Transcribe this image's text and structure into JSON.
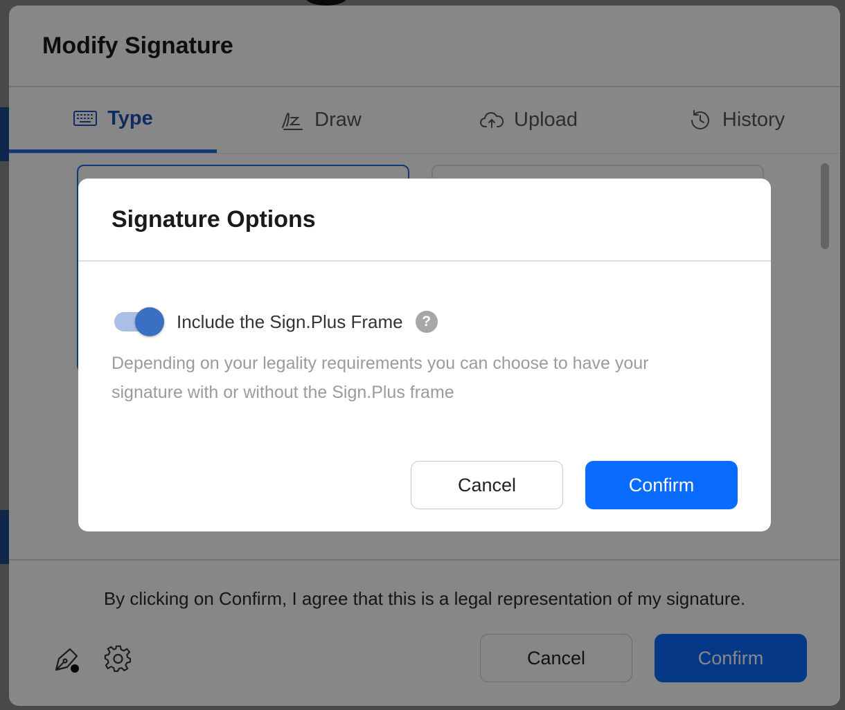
{
  "outer_modal": {
    "title": "Modify Signature",
    "tabs": [
      {
        "label": "Type",
        "icon": "keyboard-icon",
        "active": true
      },
      {
        "label": "Draw",
        "icon": "signature-draw-icon",
        "active": false
      },
      {
        "label": "Upload",
        "icon": "cloud-upload-icon",
        "active": false
      },
      {
        "label": "History",
        "icon": "history-icon",
        "active": false
      }
    ],
    "legal_text": "By clicking on Confirm, I agree that this is a legal representation of my signature.",
    "cancel_label": "Cancel",
    "confirm_label": "Confirm",
    "footer_icons": [
      "pen-nib-icon",
      "gear-icon"
    ]
  },
  "dialog": {
    "title": "Signature Options",
    "toggle_on": true,
    "option_label": "Include the Sign.Plus Frame",
    "help_symbol": "?",
    "description": "Depending on your legality requirements you can choose to have your signature with or without the Sign.Plus frame",
    "cancel_label": "Cancel",
    "confirm_label": "Confirm"
  },
  "colors": {
    "accent": "#0a6cff",
    "active_tab": "#1d54b8",
    "toggle_track": "#a9bfe6",
    "toggle_thumb": "#3b6fc4",
    "overlay": "rgba(0,0,0,0.47)"
  }
}
